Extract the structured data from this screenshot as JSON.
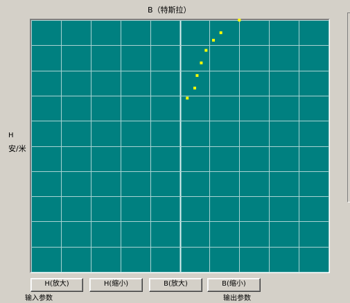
{
  "plot": {
    "title": "B（特斯拉）",
    "y_axis": {
      "symbol": "H",
      "unit": "安/米"
    }
  },
  "chart_data": {
    "type": "scatter",
    "title": "B（特斯拉）",
    "xlabel": "B（特斯拉）",
    "ylabel": "H 安/米",
    "xlim": [
      -5,
      5
    ],
    "ylim": [
      -5,
      5
    ],
    "grid": true,
    "point_color": "#ffff00",
    "background": "#008080",
    "grid_color": "#a9d3d3",
    "series": [
      {
        "values": [
          [
            0.25,
            1.9
          ],
          [
            0.5,
            2.3
          ],
          [
            0.58,
            2.8
          ],
          [
            0.72,
            3.3
          ],
          [
            0.88,
            3.8
          ],
          [
            1.13,
            4.2
          ],
          [
            1.38,
            4.5
          ],
          [
            2.0,
            5.0
          ]
        ]
      }
    ]
  },
  "controls": {
    "buttons": [
      {
        "label": "H(放大)"
      },
      {
        "label": "H(缩小)"
      },
      {
        "label": "B(放大)"
      },
      {
        "label": "B(缩小)"
      }
    ],
    "bottom_labels": {
      "left": "输入参数",
      "right": "输出参数"
    }
  }
}
